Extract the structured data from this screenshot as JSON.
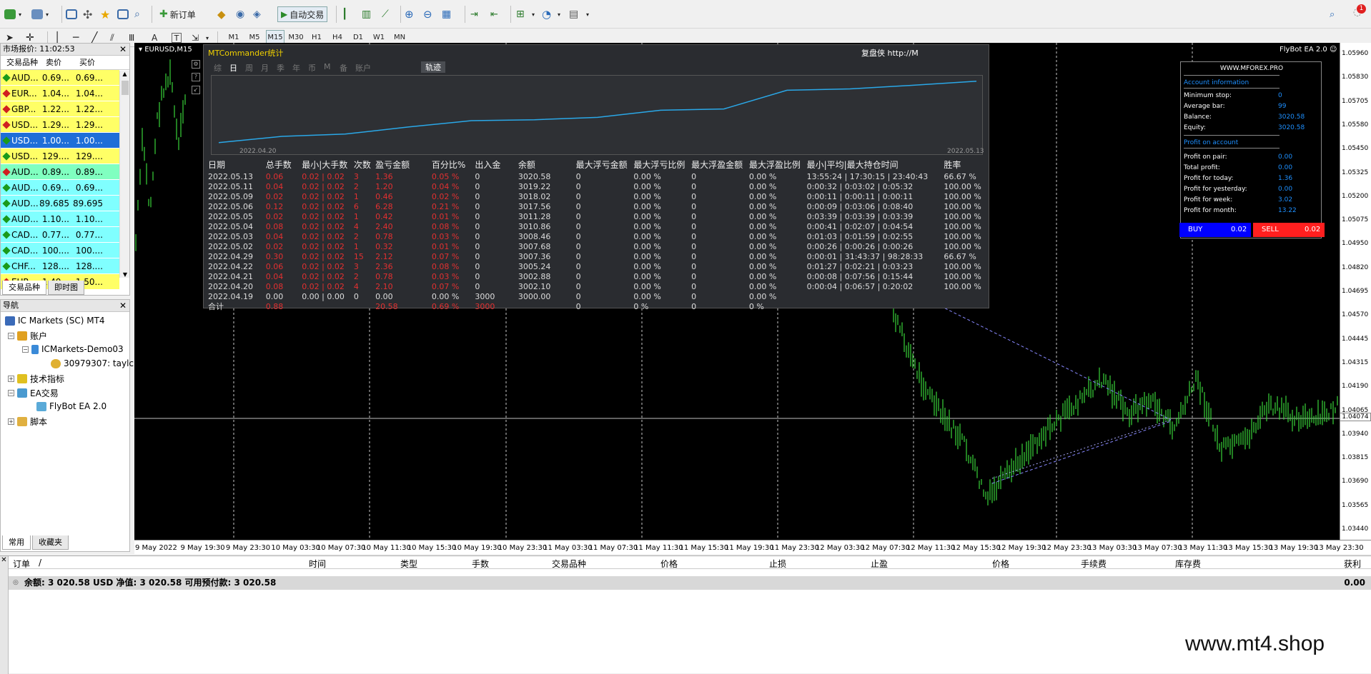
{
  "toolbar": {
    "new_order_label": "新订单",
    "auto_trading_label": "自动交易",
    "timeframes": [
      "M1",
      "M5",
      "M15",
      "M30",
      "H1",
      "H4",
      "D1",
      "W1",
      "MN"
    ],
    "active_timeframe": "M15",
    "notification_count": "1"
  },
  "market_watch": {
    "title": "市场报价: 11:02:53",
    "columns": [
      "交易品种",
      "卖价",
      "买价"
    ],
    "rows": [
      {
        "symbol": "AUD...",
        "bid": "0.69...",
        "ask": "0.69...",
        "bg": "#ffff66",
        "dir": "up"
      },
      {
        "symbol": "EUR...",
        "bid": "1.04...",
        "ask": "1.04...",
        "bg": "#ffff66",
        "dir": "down"
      },
      {
        "symbol": "GBP...",
        "bid": "1.22...",
        "ask": "1.22...",
        "bg": "#ffff66",
        "dir": "down"
      },
      {
        "symbol": "USD...",
        "bid": "1.29...",
        "ask": "1.29...",
        "bg": "#ffff66",
        "dir": "down"
      },
      {
        "symbol": "USD...",
        "bid": "1.00...",
        "ask": "1.00...",
        "bg": "#1e6ed8",
        "dir": "up",
        "selected": true
      },
      {
        "symbol": "USD...",
        "bid": "129....",
        "ask": "129....",
        "bg": "#ffff66",
        "dir": "up"
      },
      {
        "symbol": "AUD...",
        "bid": "0.89...",
        "ask": "0.89...",
        "bg": "#80ffc0",
        "dir": "down"
      },
      {
        "symbol": "AUD...",
        "bid": "0.69...",
        "ask": "0.69...",
        "bg": "#80ffff",
        "dir": "up"
      },
      {
        "symbol": "AUD...",
        "bid": "89.685",
        "ask": "89.695",
        "bg": "#80ffff",
        "dir": "up"
      },
      {
        "symbol": "AUD...",
        "bid": "1.10...",
        "ask": "1.10...",
        "bg": "#80ffff",
        "dir": "up"
      },
      {
        "symbol": "CAD...",
        "bid": "0.77...",
        "ask": "0.77...",
        "bg": "#80ffff",
        "dir": "up"
      },
      {
        "symbol": "CAD...",
        "bid": "100....",
        "ask": "100....",
        "bg": "#80ffff",
        "dir": "up"
      },
      {
        "symbol": "CHF...",
        "bid": "128....",
        "ask": "128....",
        "bg": "#80ffff",
        "dir": "up"
      },
      {
        "symbol": "EUR...",
        "bid": "1.49...",
        "ask": "1.50...",
        "bg": "#ffff66",
        "dir": "down"
      }
    ],
    "tabs": [
      "交易品种",
      "即时图"
    ]
  },
  "navigator": {
    "title": "导航",
    "items": [
      {
        "label": "IC Markets (SC) MT4",
        "level": 0
      },
      {
        "label": "账户",
        "level": 1
      },
      {
        "label": "ICMarkets-Demo03",
        "level": 2
      },
      {
        "label": "30979307: taylc",
        "level": 3
      },
      {
        "label": "技术指标",
        "level": 1
      },
      {
        "label": "EA交易",
        "level": 1
      },
      {
        "label": "FlyBot EA 2.0",
        "level": 2
      },
      {
        "label": "脚本",
        "level": 1
      }
    ],
    "tabs": [
      "常用",
      "收藏夹"
    ]
  },
  "chart": {
    "symbol_label": "EURUSD,M15",
    "ea_label": "FlyBot EA 2.0",
    "current_price": "1.04074",
    "price_ticks": [
      "1.05960",
      "1.05830",
      "1.05705",
      "1.05580",
      "1.05450",
      "1.05325",
      "1.05200",
      "1.05075",
      "1.04950",
      "1.04820",
      "1.04695",
      "1.04570",
      "1.04445",
      "1.04315",
      "1.04190",
      "1.04065",
      "1.03940",
      "1.03815",
      "1.03690",
      "1.03565",
      "1.03440"
    ],
    "time_ticks": [
      "9 May 2022",
      "9 May 19:30",
      "9 May 23:30",
      "10 May 03:30",
      "10 May 07:30",
      "10 May 11:30",
      "10 May 15:30",
      "10 May 19:30",
      "10 May 23:30",
      "11 May 03:30",
      "11 May 07:30",
      "11 May 11:30",
      "11 May 15:30",
      "11 May 19:30",
      "11 May 23:30",
      "12 May 03:30",
      "12 May 07:30",
      "12 May 11:30",
      "12 May 15:30",
      "12 May 19:30",
      "12 May 23:30",
      "13 May 03:30",
      "13 May 07:30",
      "13 May 11:30",
      "13 May 15:30",
      "13 May 19:30",
      "13 May 23:30"
    ]
  },
  "stats": {
    "title": "MTCommander统计",
    "link": "复盘侠 http://M",
    "tabs": [
      "综",
      "日",
      "周",
      "月",
      "季",
      "年",
      "币",
      "M",
      "备",
      "账户"
    ],
    "active_tab": "日",
    "trajectory_label": "轨迹",
    "graph_start": "2022.04.20",
    "graph_end": "2022.05.13",
    "headers": [
      "日期",
      "总手数",
      "最小|大手数",
      "次数",
      "盈亏金额",
      "百分比%",
      "出入金",
      "余额",
      "最大浮亏金额",
      "最大浮亏比例",
      "最大浮盈金额",
      "最大浮盈比例",
      "最小|平均|最大持仓时间",
      "胜率"
    ],
    "rows": [
      [
        "2022.05.13",
        "0.06",
        "0.02 | 0.02",
        "3",
        "1.36",
        "0.05 %",
        "0",
        "3020.58",
        "0",
        "0.00 %",
        "0",
        "0.00 %",
        "13:55:24 | 17:30:15 | 23:40:43",
        "66.67 %"
      ],
      [
        "2022.05.11",
        "0.04",
        "0.02 | 0.02",
        "2",
        "1.20",
        "0.04 %",
        "0",
        "3019.22",
        "0",
        "0.00 %",
        "0",
        "0.00 %",
        "0:00:32 | 0:03:02 | 0:05:32",
        "100.00 %"
      ],
      [
        "2022.05.09",
        "0.02",
        "0.02 | 0.02",
        "1",
        "0.46",
        "0.02 %",
        "0",
        "3018.02",
        "0",
        "0.00 %",
        "0",
        "0.00 %",
        "0:00:11 | 0:00:11 | 0:00:11",
        "100.00 %"
      ],
      [
        "2022.05.06",
        "0.12",
        "0.02 | 0.02",
        "6",
        "6.28",
        "0.21 %",
        "0",
        "3017.56",
        "0",
        "0.00 %",
        "0",
        "0.00 %",
        "0:00:09 | 0:03:06 | 0:08:40",
        "100.00 %"
      ],
      [
        "2022.05.05",
        "0.02",
        "0.02 | 0.02",
        "1",
        "0.42",
        "0.01 %",
        "0",
        "3011.28",
        "0",
        "0.00 %",
        "0",
        "0.00 %",
        "0:03:39 | 0:03:39 | 0:03:39",
        "100.00 %"
      ],
      [
        "2022.05.04",
        "0.08",
        "0.02 | 0.02",
        "4",
        "2.40",
        "0.08 %",
        "0",
        "3010.86",
        "0",
        "0.00 %",
        "0",
        "0.00 %",
        "0:00:41 | 0:02:07 | 0:04:54",
        "100.00 %"
      ],
      [
        "2022.05.03",
        "0.04",
        "0.02 | 0.02",
        "2",
        "0.78",
        "0.03 %",
        "0",
        "3008.46",
        "0",
        "0.00 %",
        "0",
        "0.00 %",
        "0:01:03 | 0:01:59 | 0:02:55",
        "100.00 %"
      ],
      [
        "2022.05.02",
        "0.02",
        "0.02 | 0.02",
        "1",
        "0.32",
        "0.01 %",
        "0",
        "3007.68",
        "0",
        "0.00 %",
        "0",
        "0.00 %",
        "0:00:26 | 0:00:26 | 0:00:26",
        "100.00 %"
      ],
      [
        "2022.04.29",
        "0.30",
        "0.02 | 0.02",
        "15",
        "2.12",
        "0.07 %",
        "0",
        "3007.36",
        "0",
        "0.00 %",
        "0",
        "0.00 %",
        "0:00:01 | 31:43:37 | 98:28:33",
        "66.67 %"
      ],
      [
        "2022.04.22",
        "0.06",
        "0.02 | 0.02",
        "3",
        "2.36",
        "0.08 %",
        "0",
        "3005.24",
        "0",
        "0.00 %",
        "0",
        "0.00 %",
        "0:01:27 | 0:02:21 | 0:03:23",
        "100.00 %"
      ],
      [
        "2022.04.21",
        "0.04",
        "0.02 | 0.02",
        "2",
        "0.78",
        "0.03 %",
        "0",
        "3002.88",
        "0",
        "0.00 %",
        "0",
        "0.00 %",
        "0:00:08 | 0:07:56 | 0:15:44",
        "100.00 %"
      ],
      [
        "2022.04.20",
        "0.08",
        "0.02 | 0.02",
        "4",
        "2.10",
        "0.07 %",
        "0",
        "3002.10",
        "0",
        "0.00 %",
        "0",
        "0.00 %",
        "0:00:04 | 0:06:57 | 0:20:02",
        "100.00 %"
      ],
      [
        "2022.04.19",
        "0.00",
        "0.00 | 0.00",
        "0",
        "0.00",
        "0.00 %",
        "3000",
        "3000.00",
        "0",
        "0.00 %",
        "0",
        "0.00 %",
        "",
        ""
      ]
    ],
    "total_row": [
      "合计",
      "0.88",
      "",
      "",
      "20.58",
      "0.69 %",
      "3000",
      "",
      "0",
      "0 %",
      "0",
      "0 %",
      "",
      ""
    ],
    "balance_curve": [
      3000.0,
      3002.1,
      3002.88,
      3005.24,
      3007.36,
      3007.68,
      3008.46,
      3010.86,
      3011.28,
      3017.56,
      3018.02,
      3019.22,
      3020.58
    ]
  },
  "account_panel": {
    "site": "WWW.MFOREX.PRO",
    "info_header": "Account information",
    "info": [
      {
        "label": "Minimum stop:",
        "value": "0"
      },
      {
        "label": "Average bar:",
        "value": "99"
      },
      {
        "label": "Balance:",
        "value": "3020.58"
      },
      {
        "label": "Equity:",
        "value": "3020.58"
      }
    ],
    "profit_header": "Profit on account",
    "profit": [
      {
        "label": "Profit on pair:",
        "value": "0.00"
      },
      {
        "label": "Total profit:",
        "value": "0.00"
      },
      {
        "label": "Profit for today:",
        "value": "1.36"
      },
      {
        "label": "Profit for yesterday:",
        "value": "0.00"
      },
      {
        "label": "Profit for week:",
        "value": "3.02"
      },
      {
        "label": "Profit for month:",
        "value": "13.22"
      }
    ],
    "buy_label": "BUY",
    "buy_lot": "0.02",
    "sell_label": "SELL",
    "sell_lot": "0.02"
  },
  "terminal": {
    "columns": [
      "订单",
      "/",
      "时间",
      "类型",
      "手数",
      "交易品种",
      "价格",
      "止损",
      "止盈",
      "价格",
      "手续费",
      "库存费",
      "获利"
    ],
    "balance_line": "余额: 3 020.58 USD  净值: 3 020.58  可用预付款: 3 020.58",
    "profit": "0.00"
  },
  "watermark": "www.mt4.shop"
}
